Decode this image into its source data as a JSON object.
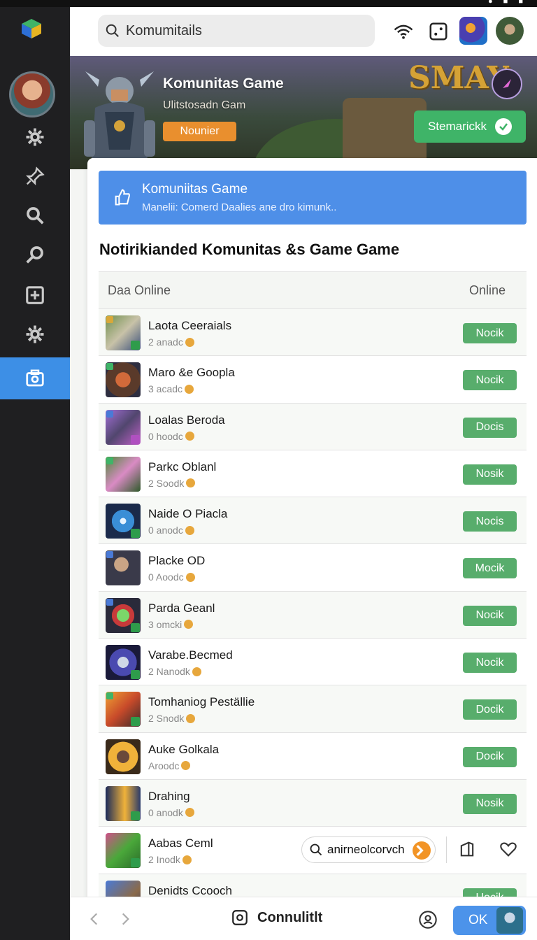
{
  "search": {
    "placeholder": "Komumitails"
  },
  "banner": {
    "title": "Komunitas Game",
    "subtitle": "Ulitstosadn Gam",
    "tag": "Nounier",
    "logo": "SMAY",
    "cta": "Stemarickk"
  },
  "info": {
    "title": "Komuniitas Game",
    "subtitle": "Manelii: Comerd Daalies ane dro kimunk.."
  },
  "section_title": "Notirikianded Komunitas &s Game Game",
  "table": {
    "col_left": "Daa  Online",
    "col_right": "Online",
    "rows": [
      {
        "name": "Laota Ceeraials",
        "meta": "2 anadc",
        "button": "Nocik"
      },
      {
        "name": "Maro &e Goopla",
        "meta": "3 acadc",
        "button": "Nocik"
      },
      {
        "name": "Loalas Beroda",
        "meta": "0 hoodc",
        "button": "Docis"
      },
      {
        "name": "Parkc Oblanl",
        "meta": "2 Soodk",
        "button": "Nosik"
      },
      {
        "name": "Naide O Piacla",
        "meta": "0 anodc",
        "button": "Nocis"
      },
      {
        "name": "Placke OD",
        "meta": "0 Aoodc",
        "button": "Mocik"
      },
      {
        "name": "Parda Geanl",
        "meta": "3 omcki",
        "button": "Nocik"
      },
      {
        "name": "Varabe.Becmed",
        "meta": "2 Nanodk",
        "button": "Nocik"
      },
      {
        "name": "Tomhaniog Peställie",
        "meta": "2 Snodk",
        "button": "Docik"
      },
      {
        "name": "Auke Golkala",
        "meta": "Aroodc",
        "button": "Docik"
      },
      {
        "name": "Drahing",
        "meta": "0 anodk",
        "button": "Nosik"
      },
      {
        "name": "Aabas Ceml",
        "meta": "2 Inodk",
        "button": ""
      },
      {
        "name": "Denidts Ccooch",
        "meta": "",
        "button": "Uocik"
      }
    ],
    "pill": "anirneolcorvch"
  },
  "bottom": {
    "center": "Connulitlt",
    "ok": "OK"
  },
  "colors": {
    "accent": "#4e8fe8",
    "green": "#58ad6c",
    "rail": "#1f1f21",
    "active": "#3d8fe6"
  }
}
